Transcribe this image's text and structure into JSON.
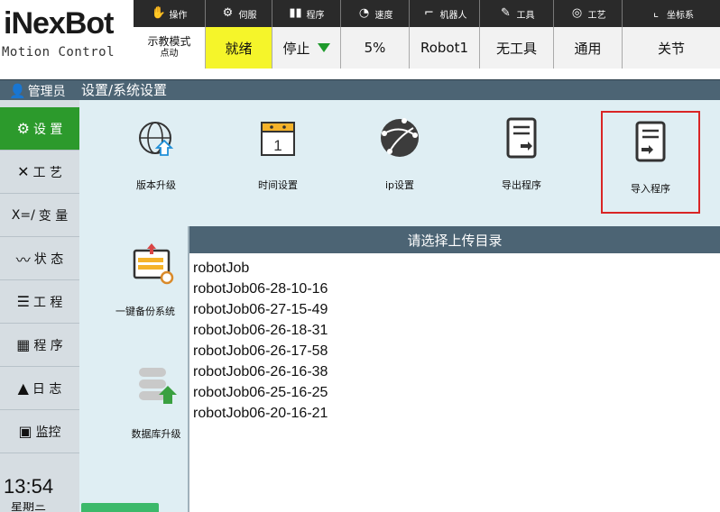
{
  "brand": {
    "name": "iNexBot",
    "subtitle": "Motion Control"
  },
  "status_labels": [
    {
      "icon": "hand-icon",
      "label": "操作"
    },
    {
      "icon": "servo-icon",
      "label": "伺服"
    },
    {
      "icon": "program-icon",
      "label": "程序"
    },
    {
      "icon": "speedometer-icon",
      "label": "速度"
    },
    {
      "icon": "robot-arm-icon",
      "label": "机器人"
    },
    {
      "icon": "tool-icon",
      "label": "工具"
    },
    {
      "icon": "process-icon",
      "label": "工艺"
    },
    {
      "icon": "coordinate-icon",
      "label": "坐标系"
    }
  ],
  "status_values": {
    "mode": "示教模式",
    "mode_sub": "点动",
    "servo": "就绪",
    "program": "停止",
    "speed": "5%",
    "robot": "Robot1",
    "tool": "无工具",
    "process": "通用",
    "coord": "关节"
  },
  "user": {
    "name": "管理员",
    "icon": "user-icon"
  },
  "breadcrumb": "设置/系统设置",
  "sidebar": [
    {
      "icon": "gear-icon",
      "label": "设 置"
    },
    {
      "icon": "wrench-icon",
      "label": "工 艺"
    },
    {
      "icon": "variable-icon",
      "label": "变 量"
    },
    {
      "icon": "status-icon",
      "label": "状 态"
    },
    {
      "icon": "list-icon",
      "label": "工 程"
    },
    {
      "icon": "code-icon",
      "label": "程 序"
    },
    {
      "icon": "warning-icon",
      "label": "日 志"
    },
    {
      "icon": "monitor-icon",
      "label": "监控"
    }
  ],
  "sidebar_prefix_var": "X=/",
  "clock": "13:54",
  "weekday": "星期三",
  "tiles": [
    {
      "label": "版本升级",
      "icon": "upgrade-icon"
    },
    {
      "label": "时间设置",
      "icon": "calendar-icon"
    },
    {
      "label": "ip设置",
      "icon": "network-icon"
    },
    {
      "label": "导出程序",
      "icon": "export-program-icon"
    },
    {
      "label": "导入程序",
      "icon": "import-program-icon"
    },
    {
      "label": "一键备份系统",
      "icon": "backup-icon"
    },
    {
      "label": "数据库升级",
      "icon": "database-upgrade-icon"
    }
  ],
  "dialog": {
    "title": "请选择上传目录",
    "items": [
      "robotJob",
      "robotJob06-28-10-16",
      "robotJob06-27-15-49",
      "robotJob06-26-18-31",
      "robotJob06-26-17-58",
      "robotJob06-26-16-38",
      "robotJob06-25-16-25",
      "robotJob06-20-16-21"
    ]
  },
  "colors": {
    "accent_green": "#2c9a2c",
    "ready_yellow": "#f5f52a",
    "titlebar": "#4c6474",
    "selection_red": "#d92525"
  }
}
